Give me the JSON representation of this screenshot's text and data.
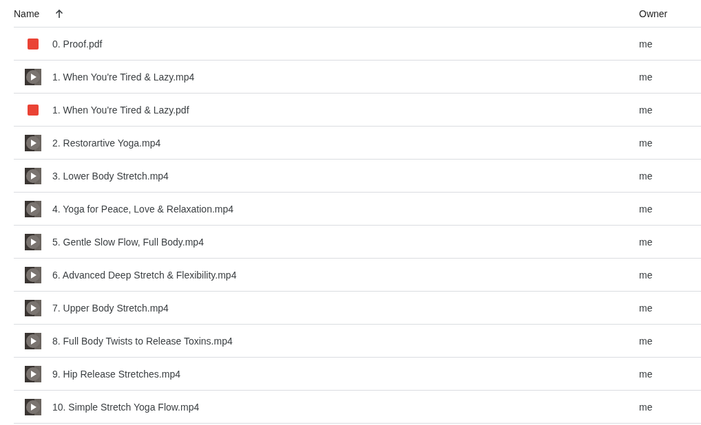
{
  "columns": [
    {
      "label": "Name",
      "sorted": true
    },
    {
      "label": "Owner"
    }
  ],
  "files": [
    {
      "kind": "pdf",
      "name": "0. Proof.pdf",
      "owner": "me"
    },
    {
      "kind": "video",
      "name": "1. When You're Tired & Lazy.mp4",
      "owner": "me"
    },
    {
      "kind": "pdf",
      "name": "1. When You're Tired & Lazy.pdf",
      "owner": "me"
    },
    {
      "kind": "video",
      "name": "2. Restorartive Yoga.mp4",
      "owner": "me"
    },
    {
      "kind": "video",
      "name": "3. Lower Body Stretch.mp4",
      "owner": "me"
    },
    {
      "kind": "video",
      "name": "4. Yoga for Peace, Love & Relaxation.mp4",
      "owner": "me"
    },
    {
      "kind": "video",
      "name": "5. Gentle Slow Flow, Full Body.mp4",
      "owner": "me"
    },
    {
      "kind": "video",
      "name": "6. Advanced Deep Stretch & Flexibility.mp4",
      "owner": "me"
    },
    {
      "kind": "video",
      "name": "7. Upper Body Stretch.mp4",
      "owner": "me"
    },
    {
      "kind": "video",
      "name": "8. Full Body Twists to Release Toxins.mp4",
      "owner": "me"
    },
    {
      "kind": "video",
      "name": "9. Hip Release Stretches.mp4",
      "owner": "me"
    },
    {
      "kind": "video",
      "name": "10. Simple Stretch Yoga Flow.mp4",
      "owner": "me"
    }
  ]
}
